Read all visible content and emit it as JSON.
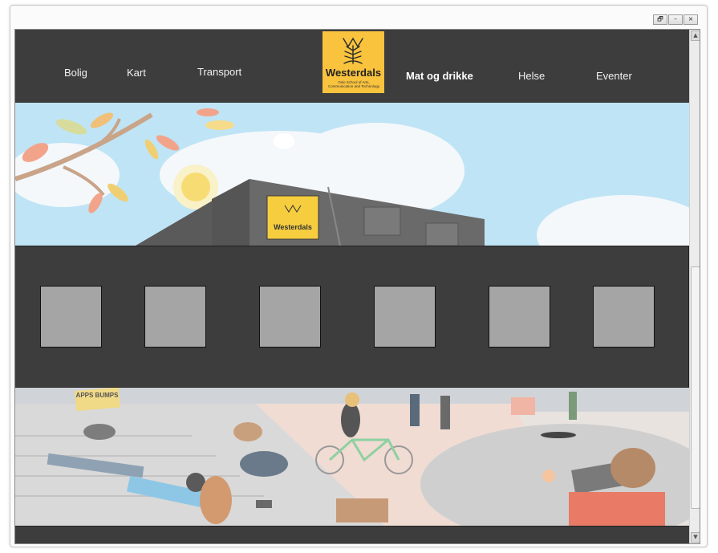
{
  "window": {
    "controls": [
      "🗗",
      "–",
      "×"
    ]
  },
  "nav": {
    "items": [
      "Bolig",
      "Kart",
      "Transport",
      "Mat og drikke",
      "Helse",
      "Eventer"
    ],
    "active": "Mat og drikke"
  },
  "logo": {
    "name": "Westerdals",
    "subtitle": "Oslo School of Arts, Communication and Technology"
  },
  "hero": {
    "sign_text": "Westerdals"
  },
  "illustration": {
    "sign_text": "APPS BUMPS"
  },
  "tiles_count": 6,
  "colors": {
    "nav_bg": "#3d3d3d",
    "tile_bg": "#a5a5a5",
    "logo_bg": "#f9c33e",
    "sky": "#bfe4f5"
  }
}
